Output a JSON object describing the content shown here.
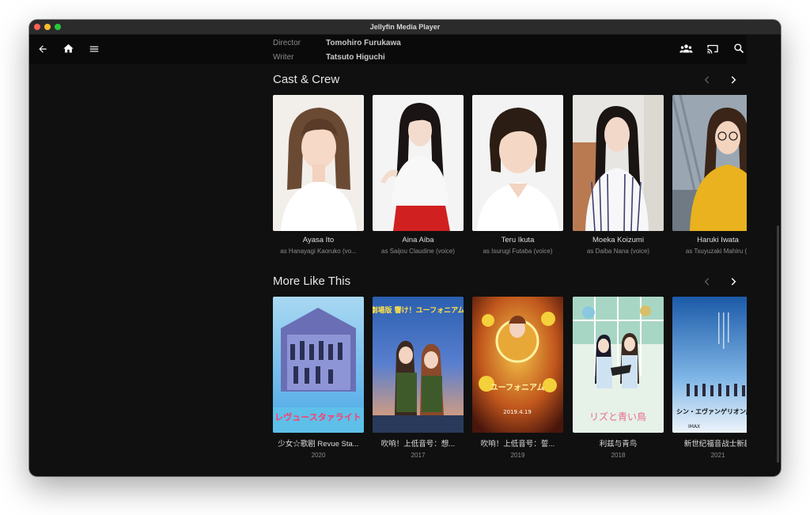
{
  "window": {
    "title": "Jellyfin Media Player"
  },
  "credits": [
    {
      "label": "Director",
      "value": "Tomohiro Furukawa"
    },
    {
      "label": "Writer",
      "value": "Tatsuto Higuchi"
    }
  ],
  "cast": {
    "title": "Cast & Crew",
    "items": [
      {
        "name": "Ayasa Ito",
        "role": "as Hanayagi Kaoruko (vo..."
      },
      {
        "name": "Aina Aiba",
        "role": "as Saijou Claudine (voice)"
      },
      {
        "name": "Teru Ikuta",
        "role": "as Isurugi Futaba (voice)"
      },
      {
        "name": "Moeka Koizumi",
        "role": "as Daiba Nana (voice)"
      },
      {
        "name": "Haruki Iwata",
        "role": "as Tsuyuzaki Mahiru (v"
      }
    ]
  },
  "similar": {
    "title": "More Like This",
    "items": [
      {
        "title": "少女☆歌剧 Revue Sta...",
        "year": "2020",
        "poster_text": "レヴュースタァライト"
      },
      {
        "title": "吹响！上低音号：想...",
        "year": "2017",
        "poster_text": "劇場版 響け！ユーフォニアム"
      },
      {
        "title": "吹响！上低音号：誓...",
        "year": "2019",
        "poster_text": "ユーフォニアム"
      },
      {
        "title": "利兹与青鸟",
        "year": "2018",
        "poster_text": "リズと青い鳥"
      },
      {
        "title": "新世纪福音战士新剧",
        "year": "2021",
        "poster_text": "シン・エヴァンゲリオン劇場"
      }
    ]
  },
  "icons": [
    "back-arrow-icon",
    "home-icon",
    "menu-icon",
    "users-icon",
    "cast-icon",
    "search-icon",
    "user-icon",
    "chevron-left-icon",
    "chevron-right-icon"
  ],
  "colors": {
    "background": "#101010",
    "topbar": "#0a0a0a",
    "accent": "#ffffff"
  }
}
